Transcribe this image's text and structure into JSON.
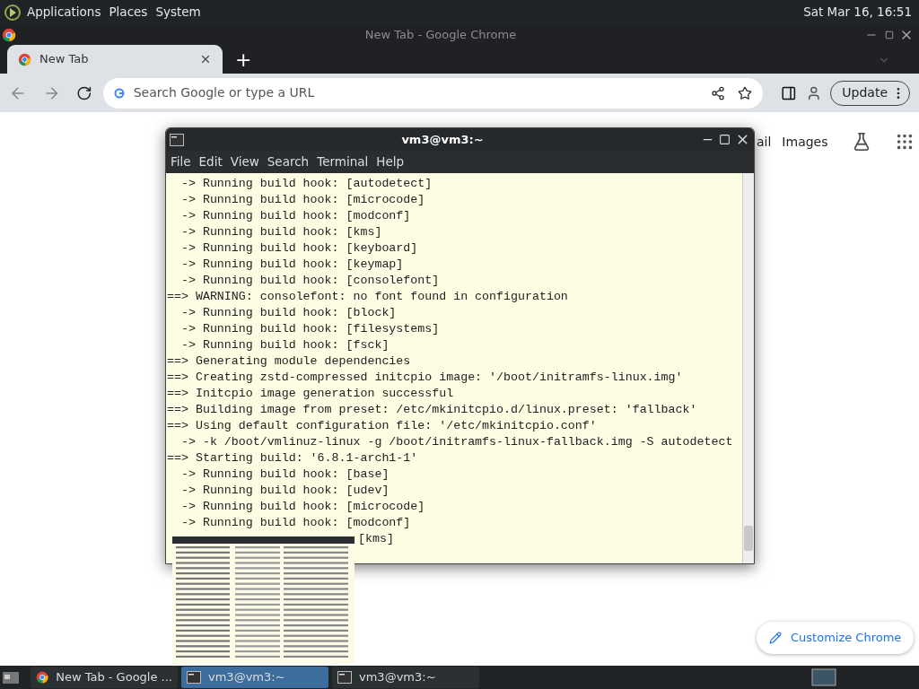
{
  "top_panel": {
    "menus": [
      "Applications",
      "Places",
      "System"
    ],
    "clock": "Sat Mar 16, 16:51"
  },
  "chrome": {
    "title": "New Tab - Google Chrome",
    "tabs": [
      {
        "label": "New Tab",
        "selected": true
      }
    ],
    "new_tab": "+",
    "omnibox": {
      "placeholder": "Search Google or type a URL"
    },
    "update": "Update",
    "page": {
      "links": [
        "ail",
        "Images"
      ],
      "customize": "Customize Chrome"
    }
  },
  "terminal": {
    "title": "vm3@vm3:~",
    "menus": [
      "File",
      "Edit",
      "View",
      "Search",
      "Terminal",
      "Help"
    ],
    "lines": [
      "  -> Running build hook: [autodetect]",
      "  -> Running build hook: [microcode]",
      "  -> Running build hook: [modconf]",
      "  -> Running build hook: [kms]",
      "  -> Running build hook: [keyboard]",
      "  -> Running build hook: [keymap]",
      "  -> Running build hook: [consolefont]",
      "==> WARNING: consolefont: no font found in configuration",
      "  -> Running build hook: [block]",
      "  -> Running build hook: [filesystems]",
      "  -> Running build hook: [fsck]",
      "==> Generating module dependencies",
      "==> Creating zstd-compressed initcpio image: '/boot/initramfs-linux.img'",
      "==> Initcpio image generation successful",
      "==> Building image from preset: /etc/mkinitcpio.d/linux.preset: 'fallback'",
      "==> Using default configuration file: '/etc/mkinitcpio.conf'",
      "  -> -k /boot/vmlinuz-linux -g /boot/initramfs-linux-fallback.img -S autodetect",
      "==> Starting build: '6.8.1-arch1-1'",
      "  -> Running build hook: [base]",
      "  -> Running build hook: [udev]",
      "  -> Running build hook: [microcode]",
      "  -> Running build hook: [modconf]"
    ],
    "last_line_visible": "[kms]"
  },
  "taskbar": {
    "items": [
      {
        "label": "New Tab - Google ...",
        "kind": "chrome",
        "selected": false
      },
      {
        "label": "vm3@vm3:~",
        "kind": "terminal",
        "selected": true
      },
      {
        "label": "vm3@vm3:~",
        "kind": "terminal",
        "selected": false
      }
    ]
  }
}
